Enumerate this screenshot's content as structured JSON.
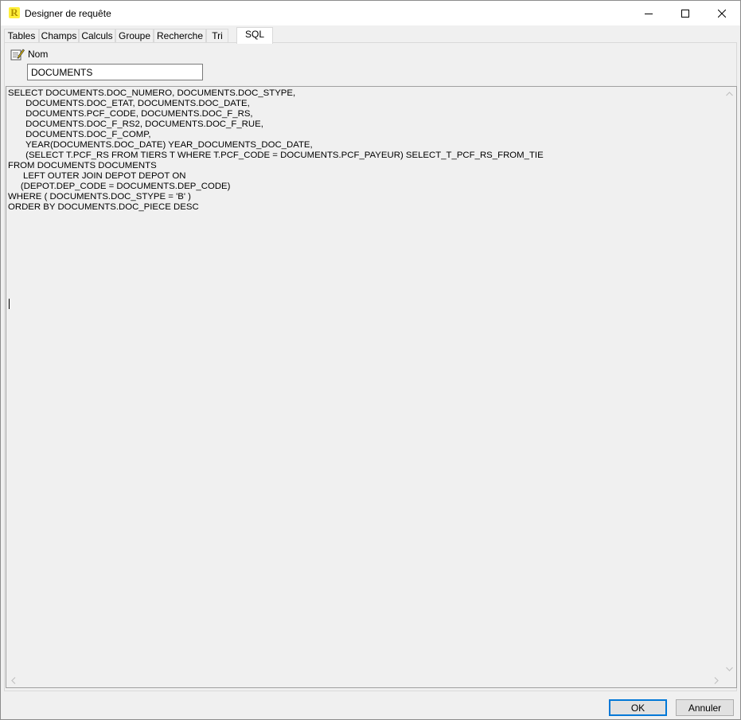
{
  "window": {
    "title": "Designer de requête"
  },
  "tabs": [
    {
      "label": "Tables"
    },
    {
      "label": "Champs"
    },
    {
      "label": "Calculs"
    },
    {
      "label": "Groupe"
    },
    {
      "label": "Recherche"
    },
    {
      "label": "Tri"
    },
    {
      "label": "SQL",
      "active": true
    }
  ],
  "name_field": {
    "label": "Nom",
    "value": "DOCUMENTS"
  },
  "sql_editor": {
    "text": "SELECT DOCUMENTS.DOC_NUMERO, DOCUMENTS.DOC_STYPE,\n       DOCUMENTS.DOC_ETAT, DOCUMENTS.DOC_DATE,\n       DOCUMENTS.PCF_CODE, DOCUMENTS.DOC_F_RS,\n       DOCUMENTS.DOC_F_RS2, DOCUMENTS.DOC_F_RUE,\n       DOCUMENTS.DOC_F_COMP,\n       YEAR(DOCUMENTS.DOC_DATE) YEAR_DOCUMENTS_DOC_DATE,\n       (SELECT T.PCF_RS FROM TIERS T WHERE T.PCF_CODE = DOCUMENTS.PCF_PAYEUR) SELECT_T_PCF_RS_FROM_TIE\nFROM DOCUMENTS DOCUMENTS\n      LEFT OUTER JOIN DEPOT DEPOT ON\n     (DEPOT.DEP_CODE = DOCUMENTS.DEP_CODE)\nWHERE ( DOCUMENTS.DOC_STYPE = 'B' )\nORDER BY DOCUMENTS.DOC_PIECE DESC"
  },
  "buttons": {
    "ok": "OK",
    "cancel": "Annuler"
  },
  "icons": {
    "app": "report-designer-icon",
    "name": "edit-note-icon"
  },
  "colors": {
    "app_icon_bg": "#ffef3a",
    "default_button_border": "#0078d7"
  }
}
